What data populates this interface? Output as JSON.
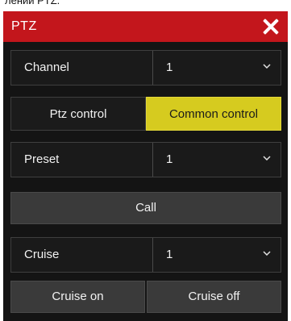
{
  "header_fragment": "лений PTZ.",
  "window": {
    "title": "PTZ",
    "accent_color": "#c3161c",
    "close_icon": "close-icon"
  },
  "channel": {
    "label": "Channel",
    "value": "1"
  },
  "tabs": [
    {
      "label": "Ptz control",
      "active": false
    },
    {
      "label": "Common control",
      "active": true,
      "color": "#d6cb1f"
    }
  ],
  "preset": {
    "label": "Preset",
    "value": "1"
  },
  "call_label": "Call",
  "cruise": {
    "label": "Cruise",
    "value": "1"
  },
  "cruise_on_label": "Cruise on",
  "cruise_off_label": "Cruise off"
}
